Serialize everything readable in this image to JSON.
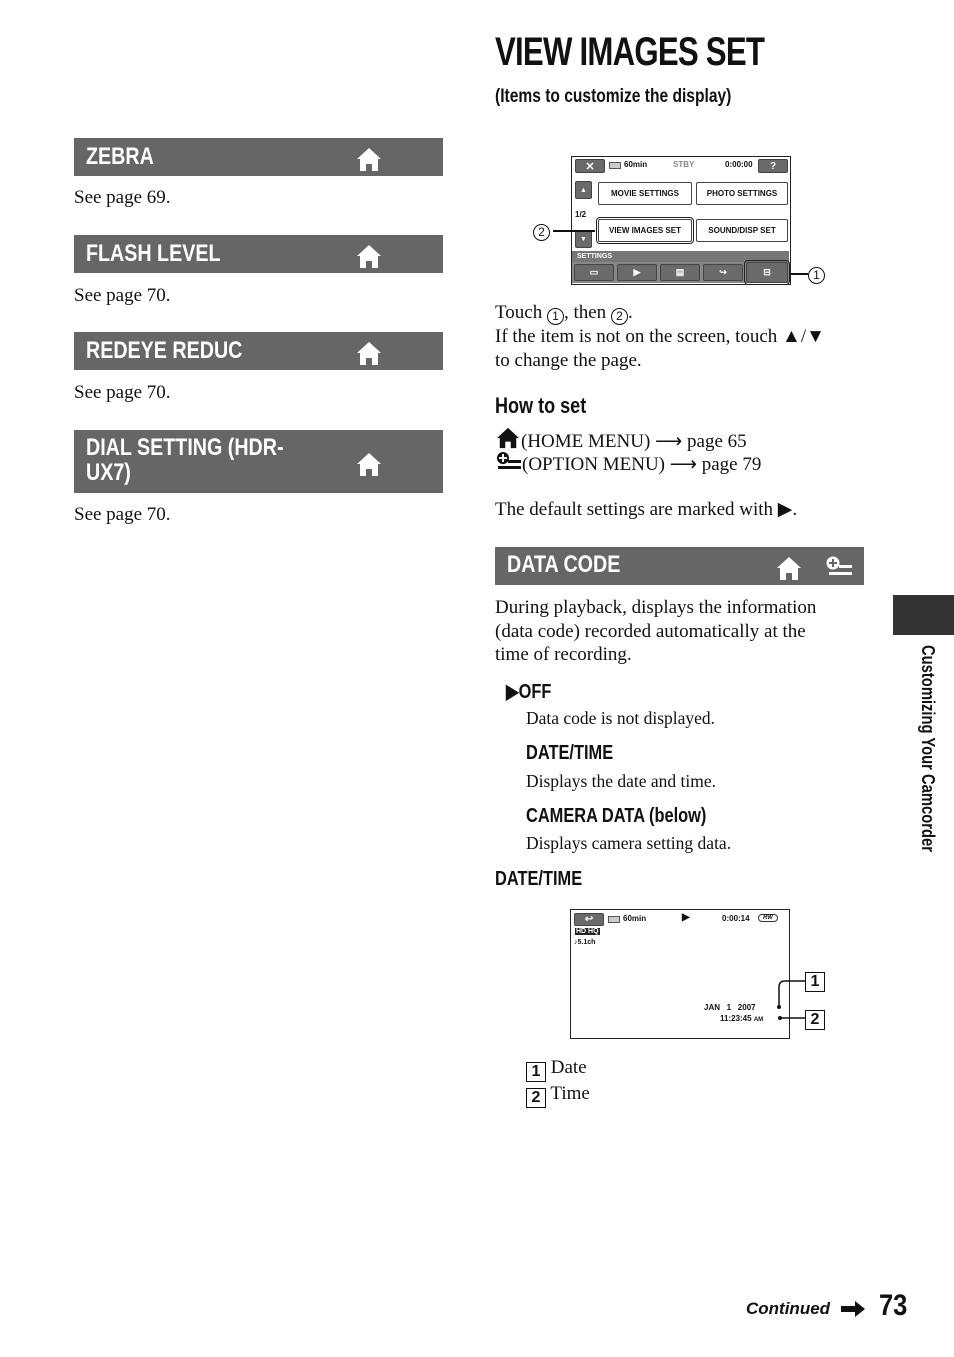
{
  "page": {
    "title": "VIEW IMAGES SET",
    "subtitle": "(Items to customize the display)",
    "side_label": "Customizing Your Camcorder",
    "continued": "Continued",
    "page_number": "73"
  },
  "left_sections": [
    {
      "title": "ZEBRA",
      "icon": "home-icon",
      "text": "See page 69."
    },
    {
      "title": "FLASH LEVEL",
      "icon": "home-icon",
      "text": "See page 70."
    },
    {
      "title": "REDEYE REDUC",
      "icon": "home-icon",
      "text": "See page 70."
    },
    {
      "title_line1": "DIAL SETTING (HDR-",
      "title_line2": "UX7)",
      "icon": "home-icon",
      "text": "See page 70."
    }
  ],
  "settings_screen": {
    "close": "✕",
    "battery": "60min",
    "status": "STBY",
    "timecode": "0:00:00",
    "help": "?",
    "page_indicator": "1/2",
    "buttons": [
      "MOVIE SETTINGS",
      "PHOTO SETTINGS",
      "VIEW IMAGES SET",
      "SOUND/DISP SET"
    ],
    "category_label": "SETTINGS",
    "callout_1": "1",
    "callout_2": "2"
  },
  "instructions": {
    "touch_prefix": "Touch",
    "touch_mid": ", then",
    "touch_end": ".",
    "line2": "If the item is not on the screen, touch ▲/▼",
    "line3": "to change the page."
  },
  "how_to_set": {
    "heading": "How to set",
    "home_menu": "(HOME MENU) ⟶ page 65",
    "option_menu": "(OPTION MENU) ⟶ page 79",
    "default_note": "The default settings are marked with ▶."
  },
  "data_code": {
    "title": "DATA CODE",
    "description": [
      "During playback, displays the information",
      "(data code) recorded automatically at the",
      "time of recording."
    ],
    "options": [
      {
        "label": "▶OFF",
        "desc": "Data code is not displayed."
      },
      {
        "label": "DATE/TIME",
        "desc": "Displays the date and time."
      },
      {
        "label": "CAMERA DATA (below)",
        "desc": "Displays camera setting data."
      }
    ],
    "example_heading": "DATE/TIME"
  },
  "playback_screen": {
    "back": "↩",
    "battery": "60min",
    "play": "▶",
    "timecode": "0:00:14",
    "media": "RW",
    "quality": "HD HQ",
    "audio": "♪5.1ch",
    "date": "JAN   1   2007",
    "time": "11:23:45",
    "ampm": "AM",
    "callout_1": "1",
    "callout_2": "2"
  },
  "legend": [
    {
      "num": "1",
      "label": "Date"
    },
    {
      "num": "2",
      "label": "Time"
    }
  ]
}
